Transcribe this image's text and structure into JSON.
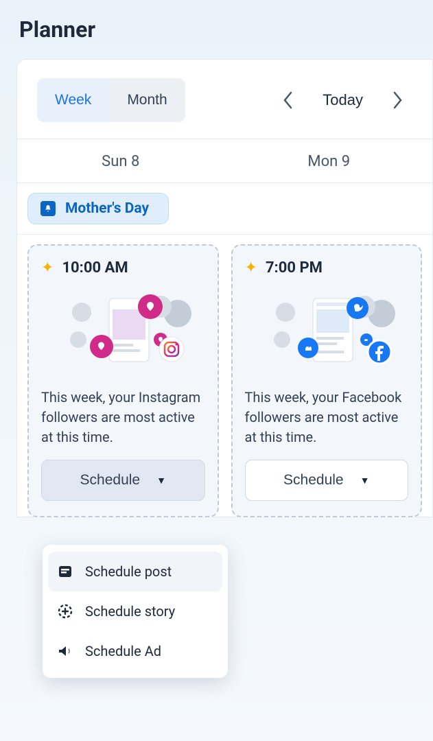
{
  "header": {
    "title": "Planner"
  },
  "toolbar": {
    "week_label": "Week",
    "month_label": "Month",
    "today_label": "Today",
    "active_tab": "week"
  },
  "days": [
    {
      "label": "Sun 8"
    },
    {
      "label": "Mon 9"
    }
  ],
  "event": {
    "label": "Mother's Day"
  },
  "cards": [
    {
      "time": "10:00 AM",
      "platform": "instagram",
      "description": "This week, your Instagram followers are most active at this time.",
      "schedule_label": "Schedule",
      "button_style": "filled"
    },
    {
      "time": "7:00 PM",
      "platform": "facebook",
      "description": "This week, your Facebook followers are most active at this time.",
      "schedule_label": "Schedule",
      "button_style": "outline"
    }
  ],
  "dropdown": {
    "items": [
      {
        "label": "Schedule post",
        "icon": "post-icon",
        "highlight": true
      },
      {
        "label": "Schedule story",
        "icon": "story-icon",
        "highlight": false
      },
      {
        "label": "Schedule Ad",
        "icon": "ad-icon",
        "highlight": false
      }
    ]
  },
  "colors": {
    "accent": "#1a73e8",
    "instagram_pink": "#d12b8a",
    "facebook_blue": "#1877f2",
    "star": "#f5b301"
  }
}
